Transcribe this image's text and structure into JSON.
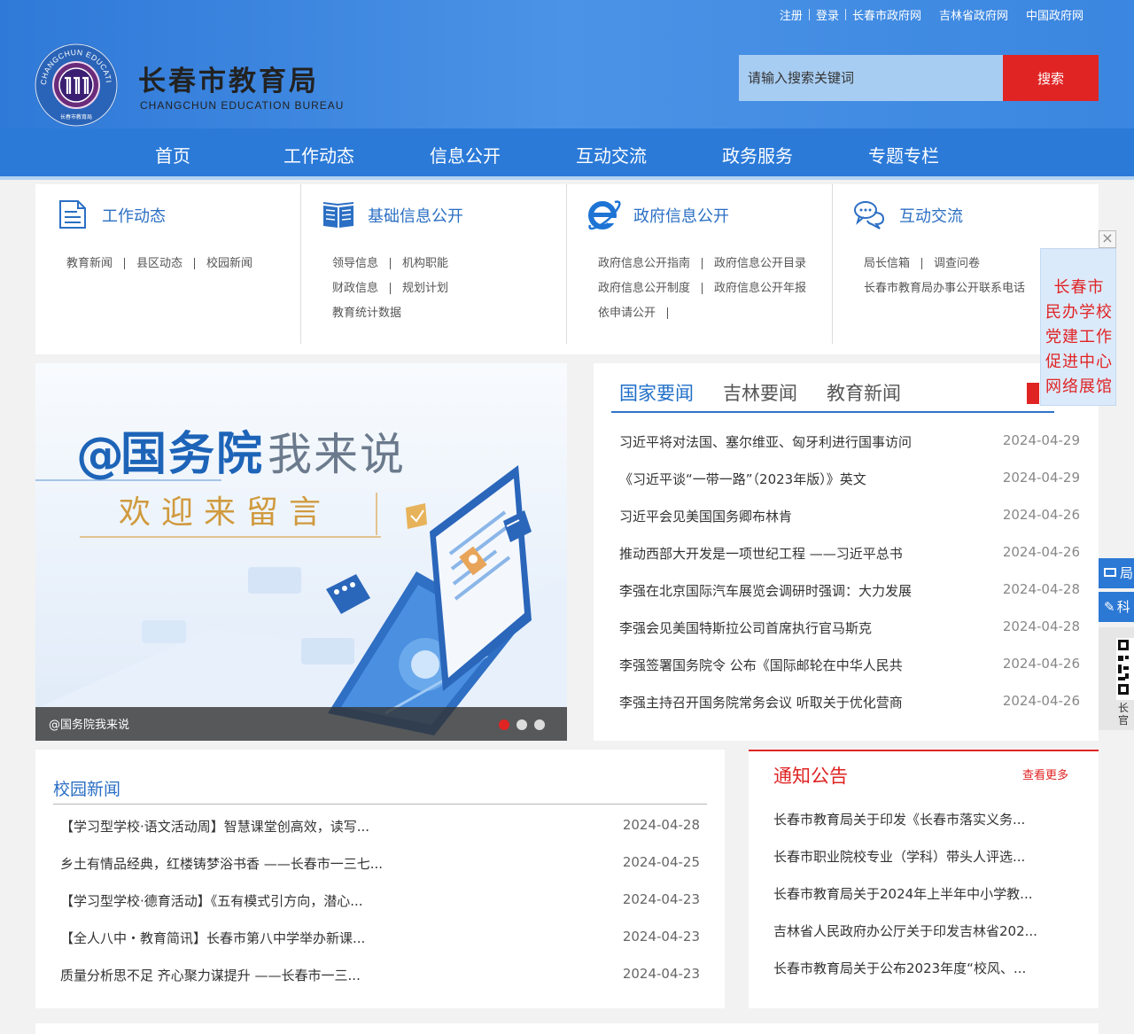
{
  "header": {
    "top_links": [
      "注册",
      "登录",
      "长春市政府网",
      "吉林省政府网",
      "中国政府网"
    ],
    "title": "长春市教育局",
    "subtitle": "CHANGCHUN EDUCATION BUREAU",
    "logo_text": "CHANGCHUN EDUCATION BUREAU",
    "logo_bottom": "长春市教育局",
    "search_placeholder": "请输入搜索关键词",
    "search_button": "搜索"
  },
  "nav": {
    "items": [
      "首页",
      "工作动态",
      "信息公开",
      "互动交流",
      "政务服务",
      "专题专栏"
    ]
  },
  "quick": [
    {
      "icon": "document-icon",
      "title": "工作动态",
      "lines": [
        [
          "教育新闻",
          "县区动态",
          "校园新闻"
        ]
      ]
    },
    {
      "icon": "book-icon",
      "title": "基础信息公开",
      "lines": [
        [
          "领导信息",
          "机构职能"
        ],
        [
          "财政信息",
          "规划计划"
        ],
        [
          "教育统计数据"
        ]
      ]
    },
    {
      "icon": "ie-browser-icon",
      "title": "政府信息公开",
      "lines": [
        [
          "政府信息公开指南",
          "政府信息公开目录"
        ],
        [
          "政府信息公开制度",
          "政府信息公开年报"
        ],
        [
          "依申请公开",
          ""
        ]
      ]
    },
    {
      "icon": "chat-bubbles-icon",
      "title": "互动交流",
      "lines": [
        [
          "局长信箱",
          "调查问卷"
        ],
        [
          "长春市教育局办事公开联系电话"
        ]
      ]
    }
  ],
  "slider": {
    "headline_at": "@",
    "headline_main": "国务院",
    "headline_sub": "我来说",
    "tagline": "欢迎来留言",
    "caption": "@国务院我来说",
    "active_index": 0,
    "count": 3,
    "colors": {
      "active_dot": "#e02424",
      "dot": "#dddddd"
    }
  },
  "news": {
    "tabs": [
      "国家要闻",
      "吉林要闻",
      "教育新闻"
    ],
    "active_tab": 0,
    "items": [
      {
        "title": "习近平将对法国、塞尔维亚、匈牙利进行国事访问",
        "date": "2024-04-29"
      },
      {
        "title": "《习近平谈“一带一路”（2023年版）》英文",
        "date": "2024-04-29"
      },
      {
        "title": "习近平会见美国国务卿布林肯",
        "date": "2024-04-26"
      },
      {
        "title": "推动西部大开发是一项世纪工程 ——习近平总书",
        "date": "2024-04-26"
      },
      {
        "title": "李强在北京国际汽车展览会调研时强调：大力发展",
        "date": "2024-04-28"
      },
      {
        "title": "李强会见美国特斯拉公司首席执行官马斯克",
        "date": "2024-04-28"
      },
      {
        "title": "李强签署国务院令 公布《国际邮轮在中华人民共",
        "date": "2024-04-26"
      },
      {
        "title": "李强主持召开国务院常务会议 听取关于优化营商",
        "date": "2024-04-26"
      }
    ]
  },
  "campus": {
    "title": "校园新闻",
    "items": [
      {
        "title": "【学习型学校·语文活动周】智慧课堂创高效，读写...",
        "date": "2024-04-28"
      },
      {
        "title": "乡土有情品经典，红楼铸梦浴书香 ——长春市一三七...",
        "date": "2024-04-25"
      },
      {
        "title": "【学习型学校·德育活动】《五有模式引方向，潜心...",
        "date": "2024-04-23"
      },
      {
        "title": "【全人八中・教育简讯】长春市第八中学举办新课...",
        "date": "2024-04-23"
      },
      {
        "title": "质量分析思不足 齐心聚力谋提升 ——长春市一三...",
        "date": "2024-04-23"
      }
    ]
  },
  "notice": {
    "title": "通知公告",
    "more": "查看更多",
    "items": [
      "长春市教育局关于印发《长春市落实义务...",
      "长春市职业院校专业（学科）带头人评选...",
      "长春市教育局关于2024年上半年中小学教...",
      "吉林省人民政府办公厅关于印发吉林省202...",
      "长春市教育局关于公布2023年度“校风、..."
    ]
  },
  "float_ad": {
    "lines": [
      "长春市",
      "民办学校",
      "党建工作",
      "促进中心",
      "网络展馆"
    ],
    "close": "×"
  },
  "side": {
    "mail_label": "局",
    "edit_label": "科",
    "qr_caption": "长",
    "qr_caption2": "官"
  },
  "colors": {
    "brand_blue": "#2b7ad8",
    "accent_red": "#e02424",
    "link_blue": "#2b6fc4"
  }
}
